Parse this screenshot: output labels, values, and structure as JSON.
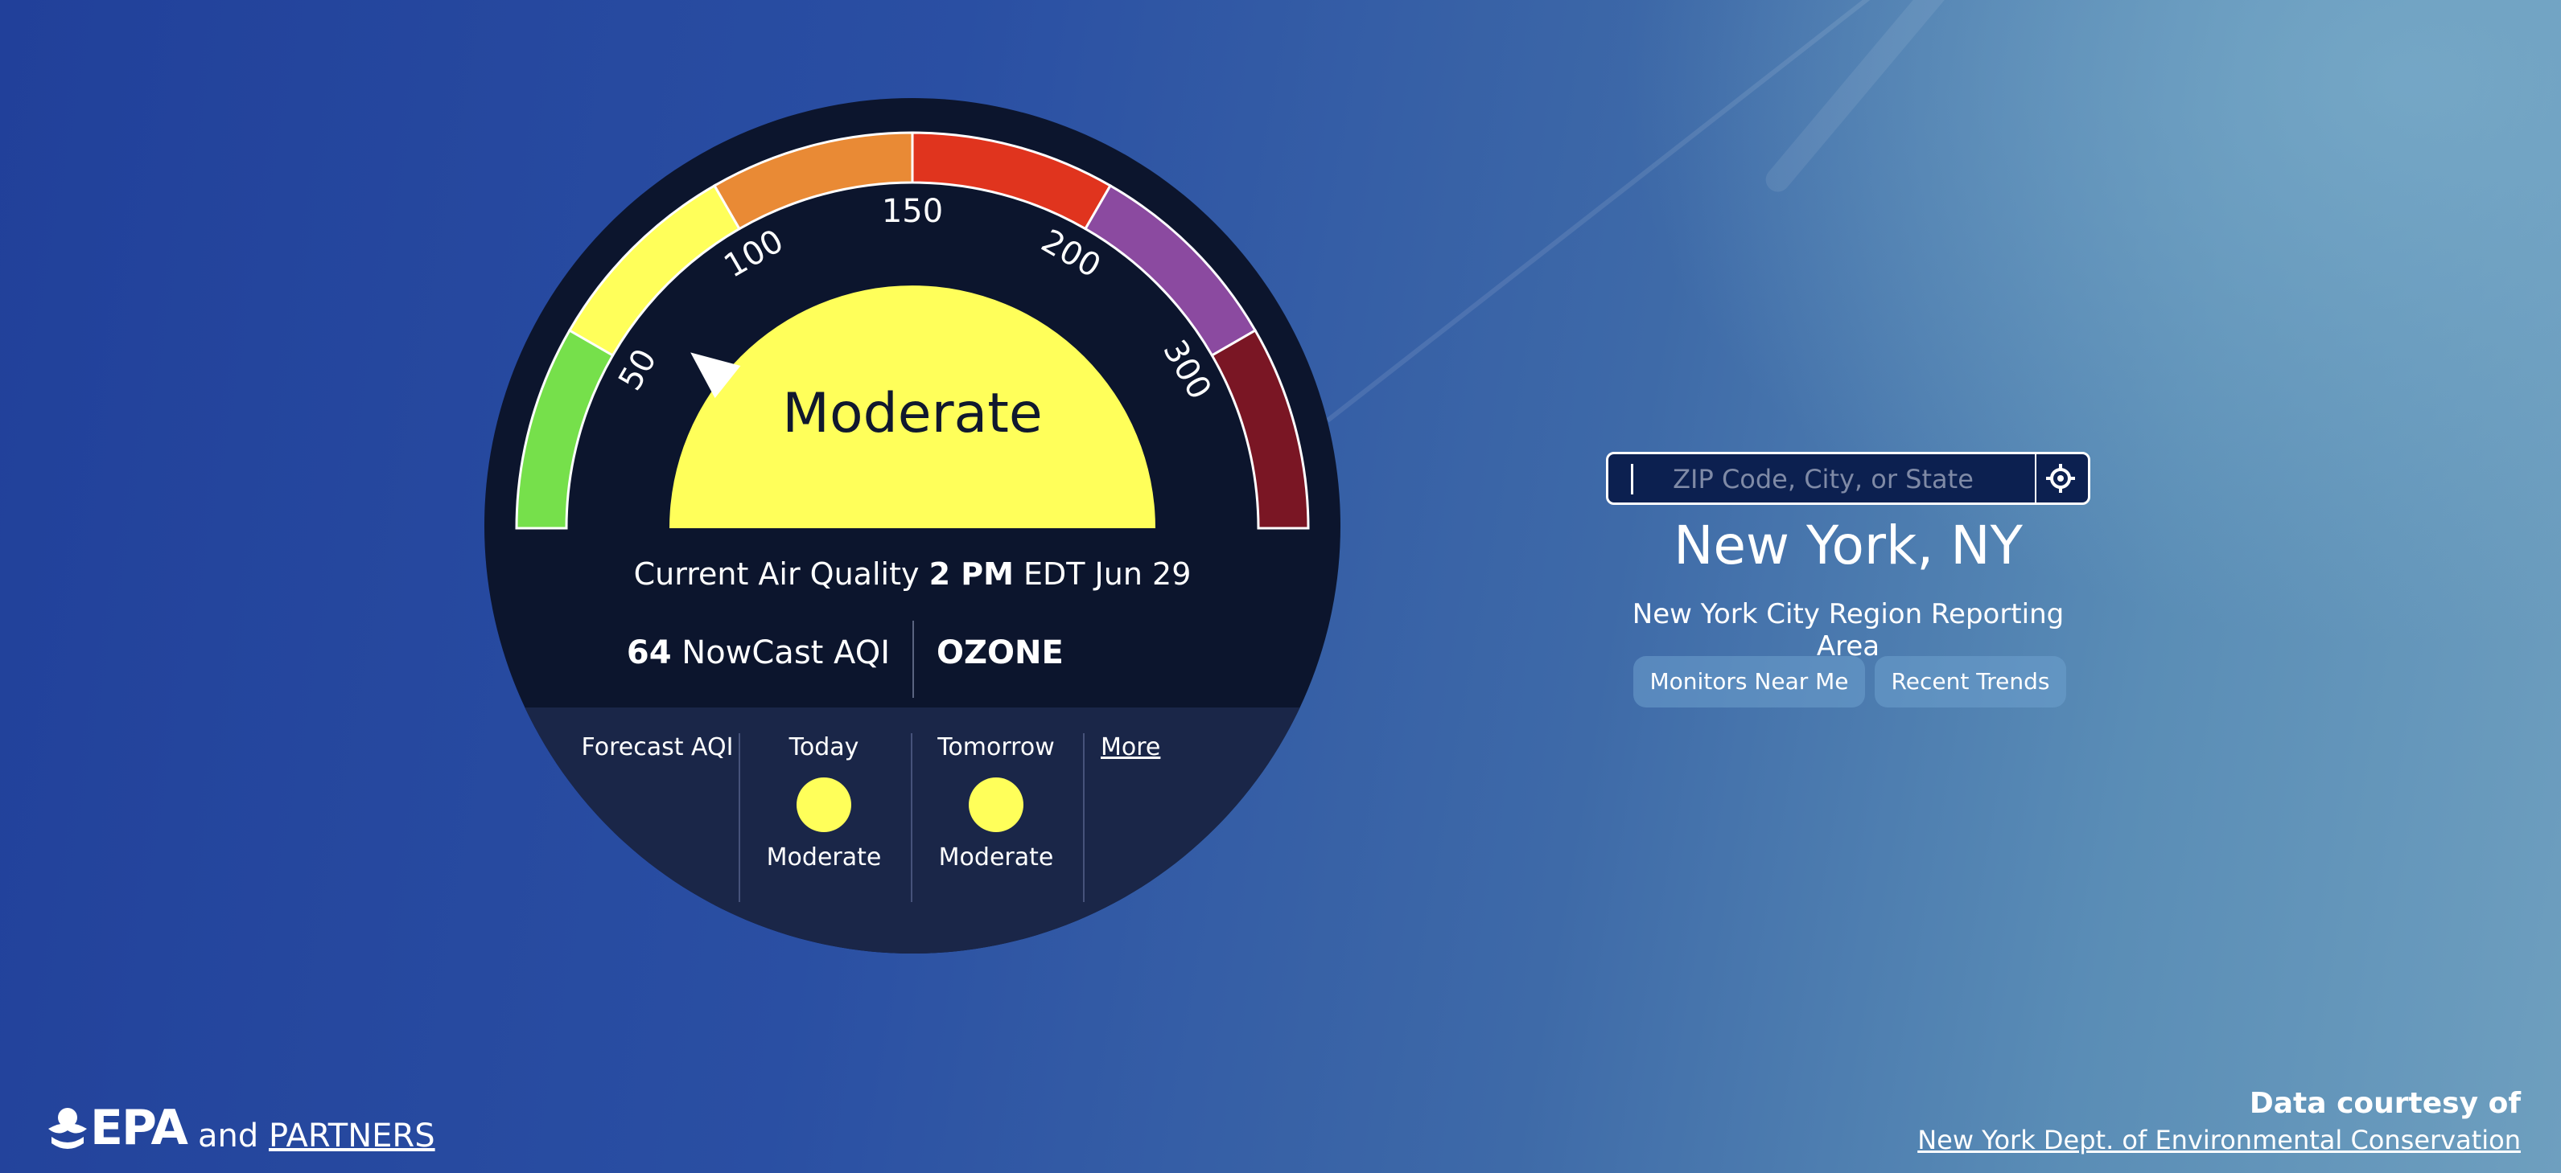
{
  "gauge": {
    "category": "Moderate",
    "tick_labels": [
      "50",
      "100",
      "150",
      "200",
      "300"
    ],
    "aqi_value": 64,
    "colors": {
      "good": "#76e04b",
      "moderate": "#ffff5a",
      "usg": "#e98a35",
      "unhealthy": "#e0341e",
      "very_unhealthy": "#8b4aa0",
      "hazardous": "#7a1624",
      "background": "#0c152d"
    }
  },
  "current": {
    "label": "Current Air Quality",
    "time": "2 PM",
    "date_text": "EDT Jun 29",
    "aqi_number": "64",
    "aqi_label": "NowCast AQI",
    "pollutant": "OZONE"
  },
  "forecast": {
    "label": "Forecast AQI",
    "today_label": "Today",
    "today_value": "Moderate",
    "tomorrow_label": "Tomorrow",
    "tomorrow_value": "Moderate",
    "more_label": "More"
  },
  "search": {
    "placeholder": "ZIP Code, City, or State",
    "value": "",
    "location_icon": "crosshair-icon"
  },
  "location": {
    "city": "New York, NY",
    "area": "New York City Region Reporting Area"
  },
  "buttons": {
    "monitors": "Monitors Near Me",
    "trends": "Recent Trends"
  },
  "footer": {
    "logo_text": "EPA",
    "and": "and",
    "partners": "PARTNERS",
    "courtesy_title": "Data courtesy of",
    "courtesy_source": "New York Dept. of Environmental Conservation"
  }
}
